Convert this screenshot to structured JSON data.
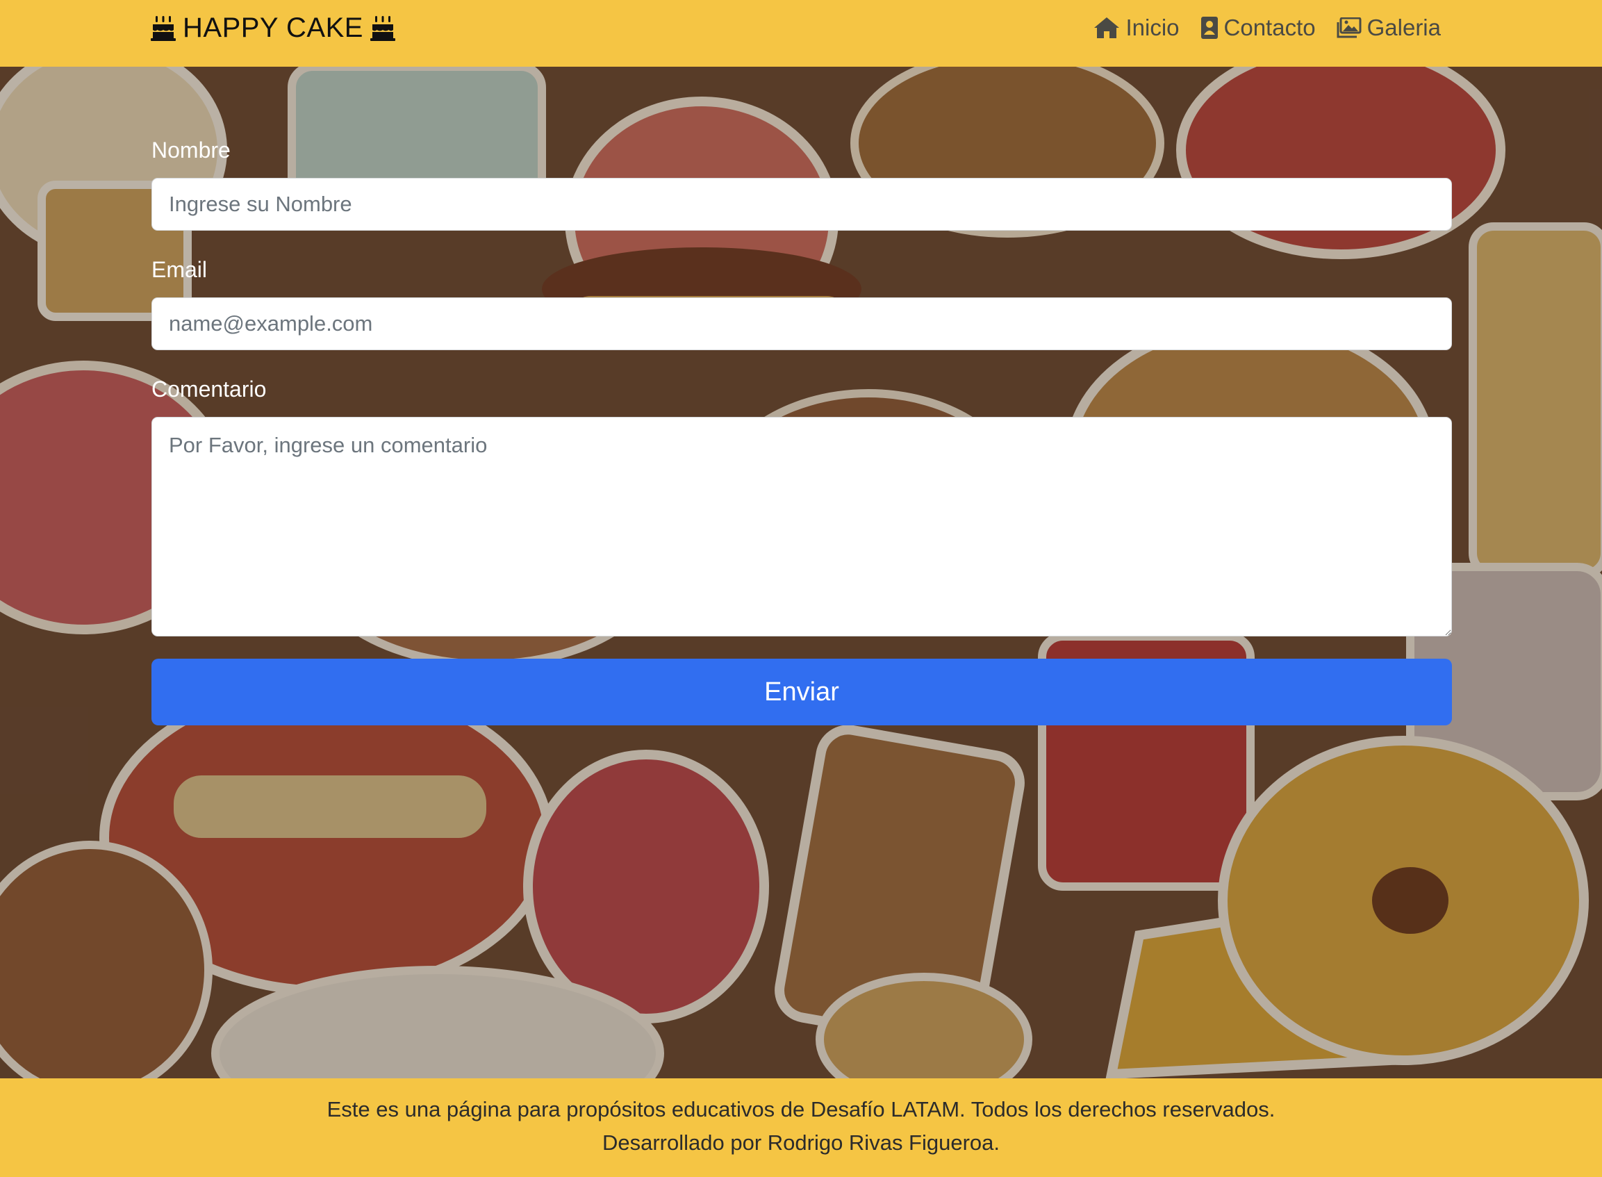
{
  "header": {
    "brand": "HAPPY CAKE",
    "brand_icon": "birthday-cake-icon",
    "nav": [
      {
        "label": "Inicio",
        "icon": "home-icon"
      },
      {
        "label": "Contacto",
        "icon": "contact-book-icon"
      },
      {
        "label": "Galeria",
        "icon": "gallery-icon"
      }
    ]
  },
  "form": {
    "name_label": "Nombre",
    "name_placeholder": "Ingrese su Nombre",
    "email_label": "Email",
    "email_placeholder": "name@example.com",
    "comment_label": "Comentario",
    "comment_placeholder": "Por Favor, ingrese un comentario",
    "submit_label": "Enviar"
  },
  "footer": {
    "line1": "Este es una página para propósitos educativos de Desafío LATAM. Todos los derechos reservados.",
    "line2": "Desarrollado por Rodrigo Rivas Figueroa."
  },
  "colors": {
    "brand_yellow": "#f5c544",
    "primary_button": "#316ef0",
    "nav_text": "#4a4a44"
  }
}
